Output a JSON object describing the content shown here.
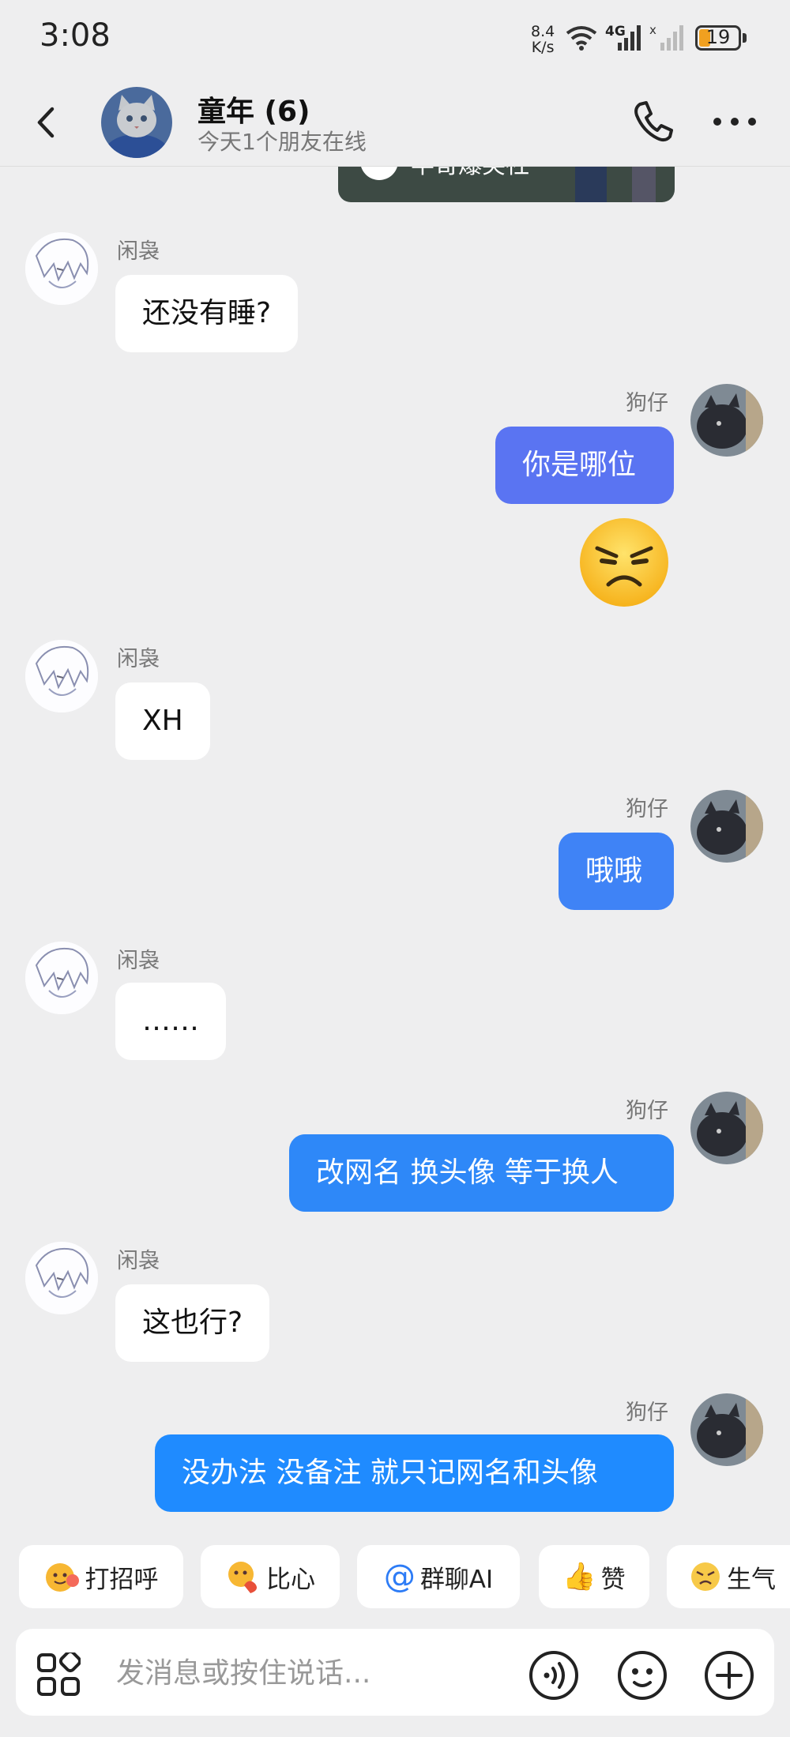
{
  "status_bar": {
    "time": "3:08",
    "speed_value": "8.4",
    "speed_unit": "K/s",
    "network": "4G",
    "battery": "19"
  },
  "header": {
    "title": "童年 (6)",
    "subtitle": "今天1个朋友在线"
  },
  "shared_card": {
    "text": "半哥爆笑社"
  },
  "messages": [
    {
      "sender": "闲袅",
      "text": "还没有睡?"
    },
    {
      "sender": "狗仔",
      "text": "你是哪位"
    },
    {
      "sender": "闲袅",
      "text": "XH"
    },
    {
      "sender": "狗仔",
      "text": "哦哦"
    },
    {
      "sender": "闲袅",
      "text": "……"
    },
    {
      "sender": "狗仔",
      "text": "改网名 换头像 等于换人"
    },
    {
      "sender": "闲袅",
      "text": "这也行?"
    },
    {
      "sender": "狗仔",
      "text": "没办法  没备注 就只记网名和头像"
    }
  ],
  "quick_actions": [
    {
      "label": "打招呼",
      "icon": "wave-emoji-icon"
    },
    {
      "label": "比心",
      "icon": "heart-hands-emoji-icon"
    },
    {
      "label": "群聊AI",
      "icon": "at-sign-icon",
      "glyph": "@"
    },
    {
      "label": "赞",
      "icon": "thumbs-up-icon",
      "glyph": "👍"
    },
    {
      "label": "生气",
      "icon": "angry-emoji-icon"
    }
  ],
  "input": {
    "placeholder": "发消息或按住说话..."
  },
  "colors": {
    "background": "#eeeeef",
    "outgoing_bubble_top": "#5b73f2",
    "outgoing_bubble_bottom": "#1f8bff",
    "incoming_bubble": "#ffffff"
  }
}
